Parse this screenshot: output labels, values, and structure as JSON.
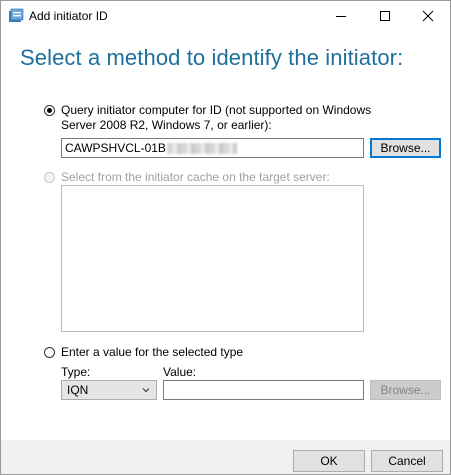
{
  "window": {
    "title": "Add initiator ID",
    "controls": {
      "minimize": "minimize-icon",
      "maximize": "maximize-icon",
      "close": "close-icon"
    }
  },
  "heading": "Select a method to identify the initiator:",
  "option_query": {
    "label_line1": "Query initiator computer for ID (not supported on Windows",
    "label_line2": "Server 2008 R2, Windows 7, or earlier):",
    "selected": true,
    "computer_value": "CAWPSHVCL-01B",
    "browse_label": "Browse..."
  },
  "option_cache": {
    "label": "Select from the initiator cache on the target server:",
    "selected": false,
    "enabled": false
  },
  "option_value": {
    "label": "Enter a value for the selected type",
    "selected": false,
    "type_label": "Type:",
    "type_value": "IQN",
    "value_label": "Value:",
    "value": "",
    "browse_label": "Browse..."
  },
  "footer": {
    "ok_label": "OK",
    "cancel_label": "Cancel"
  },
  "colors": {
    "heading": "#1e6f9b",
    "focus_border": "#0078d7",
    "footer_bg": "#f0f0f0"
  }
}
